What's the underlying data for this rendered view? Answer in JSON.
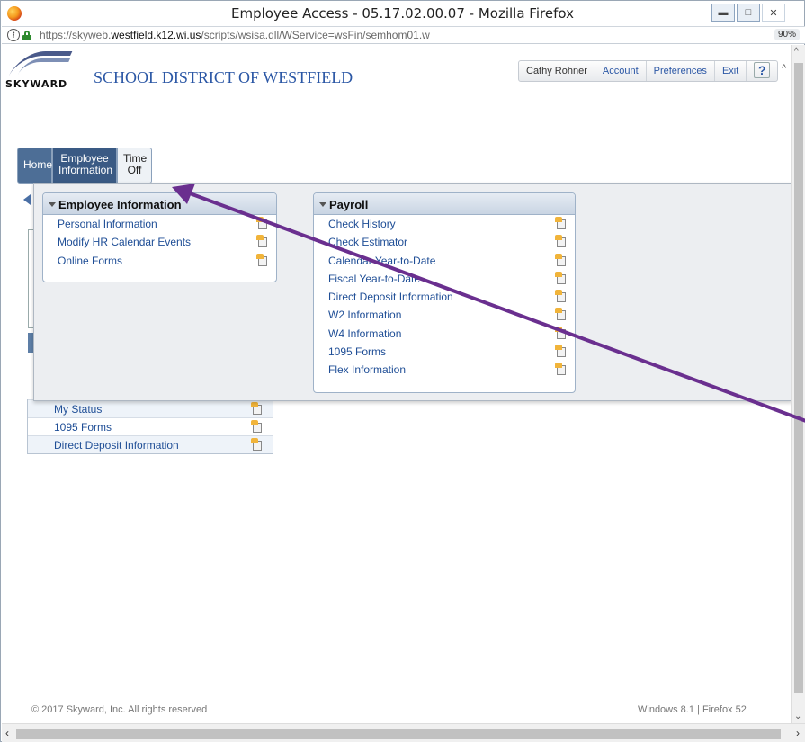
{
  "window": {
    "title": "Employee Access - 05.17.02.00.07 - Mozilla Firefox"
  },
  "address_bar": {
    "url_prefix": "https://skyweb.",
    "url_domain": "westfield.k12.wi.us",
    "url_path": "/scripts/wsisa.dll/WService=wsFin/semhom01.w",
    "zoom": "90%"
  },
  "header": {
    "logo_text": "SKYWARD",
    "district_name": "SCHOOL DISTRICT OF WESTFIELD",
    "user_name": "Cathy Rohner",
    "links": [
      "Account",
      "Preferences",
      "Exit"
    ],
    "help": "?"
  },
  "tabs": [
    {
      "label": "Home"
    },
    {
      "label": "Employee Information"
    },
    {
      "label": "Time Off"
    }
  ],
  "employee_menu": {
    "title": "Employee Information",
    "items": [
      "Personal Information",
      "Modify HR Calendar Events",
      "Online Forms"
    ]
  },
  "payroll_menu": {
    "title": "Payroll",
    "items": [
      "Check History",
      "Check Estimator",
      "Calendar Year-to-Date",
      "Fiscal Year-to-Date",
      "Direct Deposit Information",
      "W2 Information",
      "W4 Information",
      "1095 Forms",
      "Flex Information"
    ]
  },
  "background_list": [
    "My Status",
    "1095 Forms",
    "Direct Deposit Information"
  ],
  "footer": {
    "left": "© 2017 Skyward, Inc. All rights reserved",
    "right": "Windows 8.1 | Firefox 52"
  },
  "colors": {
    "annotation_arrow": "#6a2f8f",
    "link_blue": "#1f4e96"
  }
}
